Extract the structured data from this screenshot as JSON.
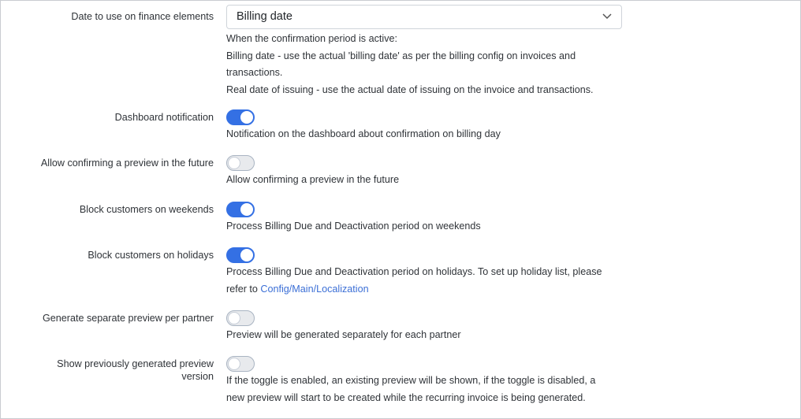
{
  "settings": {
    "finance_date": {
      "label": "Date to use on finance elements",
      "selected": "Billing date",
      "help_line1": "When the confirmation period is active:",
      "help_line2": "Billing date - use the actual 'billing date' as per the billing config on invoices and",
      "help_line3": "transactions.",
      "help_line4": "Real date of issuing - use the actual date of issuing on the invoice and transactions."
    },
    "dashboard_notification": {
      "label": "Dashboard notification",
      "enabled": true,
      "help": "Notification on the dashboard about confirmation on billing day"
    },
    "allow_confirm_future": {
      "label": "Allow confirming a preview in the future",
      "enabled": false,
      "help": "Allow confirming a preview in the future"
    },
    "block_weekends": {
      "label": "Block customers on weekends",
      "enabled": true,
      "help": "Process Billing Due and Deactivation period on weekends"
    },
    "block_holidays": {
      "label": "Block customers on holidays",
      "enabled": true,
      "help_line1": "Process Billing Due and Deactivation period on holidays. To set up holiday list, please",
      "help_line2_prefix": "refer to ",
      "help_link": "Config/Main/Localization"
    },
    "separate_preview": {
      "label": "Generate separate preview per partner",
      "enabled": false,
      "help": "Preview will be generated separately for each partner"
    },
    "show_previous_preview": {
      "label_line1": "Show previously generated preview",
      "label_line2": "version",
      "enabled": false,
      "help_line1": "If the toggle is enabled, an existing preview will be shown, if the toggle is disabled, a",
      "help_line2": "new preview will start to be created while the recurring invoice is being generated."
    }
  },
  "icons": {
    "select_chevron": "chevron-down-icon"
  },
  "colors": {
    "toggle_on": "#3470e4",
    "toggle_off": "#e8eaed",
    "link": "#3b6fd6"
  }
}
